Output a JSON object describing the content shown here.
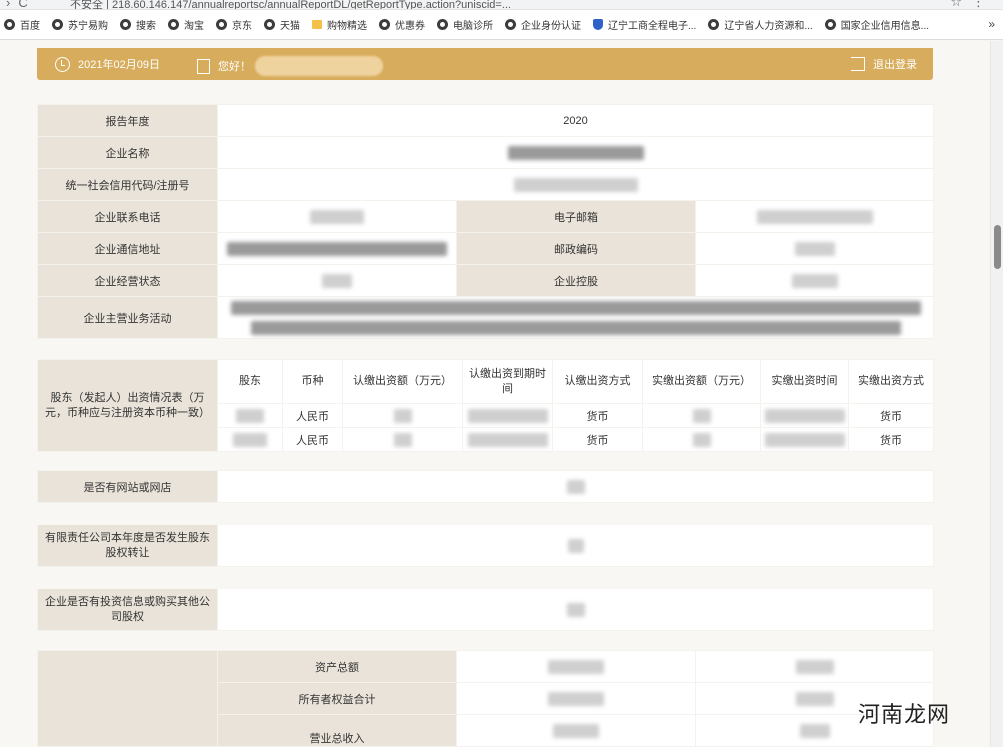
{
  "browser": {
    "url_text": "不安全 | 218.60.146.147/annualreportsc/annualReportDL/getReportType.action?uniscid=...",
    "bookmarks": [
      "百度",
      "苏宁易购",
      "搜索",
      "淘宝",
      "京东",
      "天猫",
      "购物精选",
      "优惠券",
      "电脑诊所",
      "企业身份认证",
      "辽宁工商全程电子...",
      "辽宁省人力资源和...",
      "国家企业信用信息..."
    ],
    "more": "»"
  },
  "header": {
    "date": "2021年02月09日",
    "greeting": "您好！",
    "logout": "退出登录"
  },
  "basic": {
    "report_year_label": "报告年度",
    "report_year_value": "2020",
    "company_name_label": "企业名称",
    "credit_code_label": "统一社会信用代码/注册号",
    "phone_label": "企业联系电话",
    "email_label": "电子邮箱",
    "address_label": "企业通信地址",
    "postcode_label": "邮政编码",
    "status_label": "企业经营状态",
    "holding_label": "企业控股",
    "business_label": "企业主营业务活动"
  },
  "shareholders": {
    "section_label": "股东（发起人）出资情况表（万元，币种应与注册资本币种一致）",
    "columns": [
      "股东",
      "币种",
      "认缴出资额（万元）",
      "认缴出资到期时间",
      "认缴出资方式",
      "实缴出资额（万元）",
      "实缴出资时间",
      "实缴出资方式"
    ],
    "rows": [
      {
        "currency": "人民币",
        "sub_method": "货币",
        "paid_method": "货币"
      },
      {
        "currency": "人民币",
        "sub_method": "货币",
        "paid_method": "货币"
      }
    ]
  },
  "questions": {
    "website_label": "是否有网站或网店",
    "transfer_label": "有限责任公司本年度是否发生股东股权转让",
    "invest_label": "企业是否有投资信息或购买其他公司股权"
  },
  "assets": {
    "total_assets_label": "资产总额",
    "equity_label": "所有者权益合计",
    "revenue_label": "营业总收入"
  },
  "watermark": "河南龙网"
}
